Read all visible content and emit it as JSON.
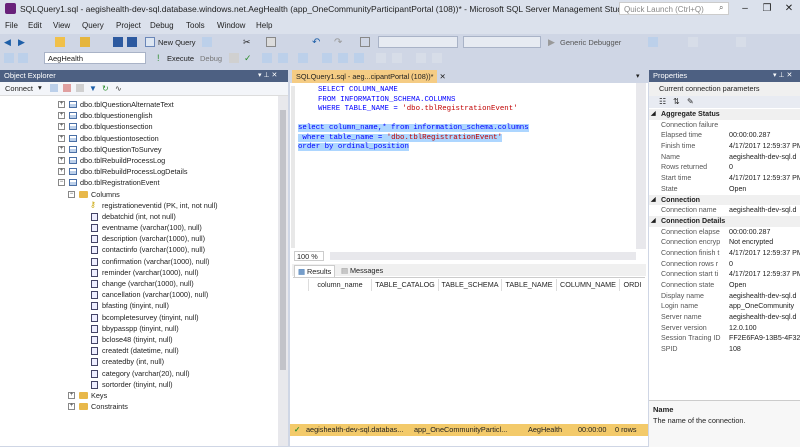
{
  "window": {
    "title": "SQLQuery1.sql - aegishealth-dev-sql.database.windows.net.AegHealth (app_OneCommunityParticipantPortal (108))* - Microsoft SQL Server Management Studio",
    "quick_launch_placeholder": "Quick Launch (Ctrl+Q)"
  },
  "menu": [
    "File",
    "Edit",
    "View",
    "Query",
    "Project",
    "Debug",
    "Tools",
    "Window",
    "Help"
  ],
  "toolbar": {
    "new_query": "New Query",
    "database": "AegHealth",
    "execute": "Execute",
    "debug": "Debug",
    "debugger": "Generic Debugger"
  },
  "object_explorer": {
    "title": "Object Explorer",
    "connect": "Connect",
    "tables": [
      "dbo.tblQuestionAlternateText",
      "dbo.tblquestionenglish",
      "dbo.tblquestionsection",
      "dbo.tblquestiontosection",
      "dbo.tblQuestionToSurvey",
      "dbo.tblRebuildProcessLog",
      "dbo.tblRebuildProcessLogDetails",
      "dbo.tblRegistrationEvent"
    ],
    "columns_folder": "Columns",
    "columns": [
      "registrationeventid (PK, int, not null)",
      "debatchid (int, not null)",
      "eventname (varchar(100), null)",
      "description (varchar(1000), null)",
      "contactinfo (varchar(1000), null)",
      "confirmation (varchar(1000), null)",
      "reminder (varchar(1000), null)",
      "change (varchar(1000), null)",
      "cancellation (varchar(1000), null)",
      "bfasting (tinyint, null)",
      "bcompletesurvey (tinyint, null)",
      "bbypasspp (tinyint, null)",
      "bclose48 (tinyint, null)",
      "createdt (datetime, null)",
      "createdby (int, null)",
      "category (varchar(20), null)",
      "sortorder (tinyint, null)"
    ],
    "keys_folder": "Keys",
    "constraints_folder": "Constraints"
  },
  "editor": {
    "tab": "SQLQuery1.sql - aeg...cipantPortal (108))*",
    "zoom": "100 %",
    "query1": {
      "select": "SELECT COLUMN_NAME",
      "from": "FROM INFORMATION_SCHEMA.COLUMNS",
      "where_kw": "WHERE TABLE_NAME = ",
      "where_val": "'dbo.tblRegistrationEvent'"
    },
    "query2": {
      "select": "select column_name,* from information_schema.columns",
      "where_kw": " where table_name = ",
      "where_val": "'dbo.tblRegistrationEvent'",
      "order": "order by ordinal_position"
    }
  },
  "results": {
    "tab_results": "Results",
    "tab_messages": "Messages",
    "columns": [
      "column_name",
      "TABLE_CATALOG",
      "TABLE_SCHEMA",
      "TABLE_NAME",
      "COLUMN_NAME",
      "ORDI"
    ]
  },
  "statusbar": {
    "server": "aegishealth-dev-sql.databas...",
    "user": "app_OneCommunityParticl...",
    "db": "AegHealth",
    "time": "00:00:00",
    "rows": "0 rows"
  },
  "properties": {
    "title": "Properties",
    "subtitle": "Current connection parameters",
    "sections": [
      {
        "name": "Aggregate Status",
        "rows": [
          [
            "Connection failure",
            ""
          ],
          [
            "Elapsed time",
            "00:00:00.287"
          ],
          [
            "Finish time",
            "4/17/2017 12:59:37 PM"
          ],
          [
            "Name",
            "aegishealth-dev-sql.d"
          ],
          [
            "Rows returned",
            "0"
          ],
          [
            "Start time",
            "4/17/2017 12:59:37 PM"
          ],
          [
            "State",
            "Open"
          ]
        ]
      },
      {
        "name": "Connection",
        "rows": [
          [
            "Connection name",
            "aegishealth-dev-sql.d"
          ]
        ]
      },
      {
        "name": "Connection Details",
        "rows": [
          [
            "Connection elapse",
            "00:00:00.287"
          ],
          [
            "Connection encryp",
            "Not encrypted"
          ],
          [
            "Connection finish t",
            "4/17/2017 12:59:37 PM"
          ],
          [
            "Connection rows r",
            "0"
          ],
          [
            "Connection start ti",
            "4/17/2017 12:59:37 PM"
          ],
          [
            "Connection state",
            "Open"
          ],
          [
            "Display name",
            "aegishealth-dev-sql.d"
          ],
          [
            "Login name",
            "app_OneCommunity"
          ],
          [
            "Server name",
            "aegishealth-dev-sql.d"
          ],
          [
            "Server version",
            "12.0.100"
          ],
          [
            "Session Tracing ID",
            "FF2E6FA9-13B5-4F32"
          ],
          [
            "SPID",
            "108"
          ]
        ]
      }
    ],
    "desc_name": "Name",
    "desc_text": "The name of the connection."
  },
  "colors": {
    "panel_title": "#4d6082",
    "status_bar": "#f3ca6a",
    "active_tab": "#f5cc84"
  }
}
